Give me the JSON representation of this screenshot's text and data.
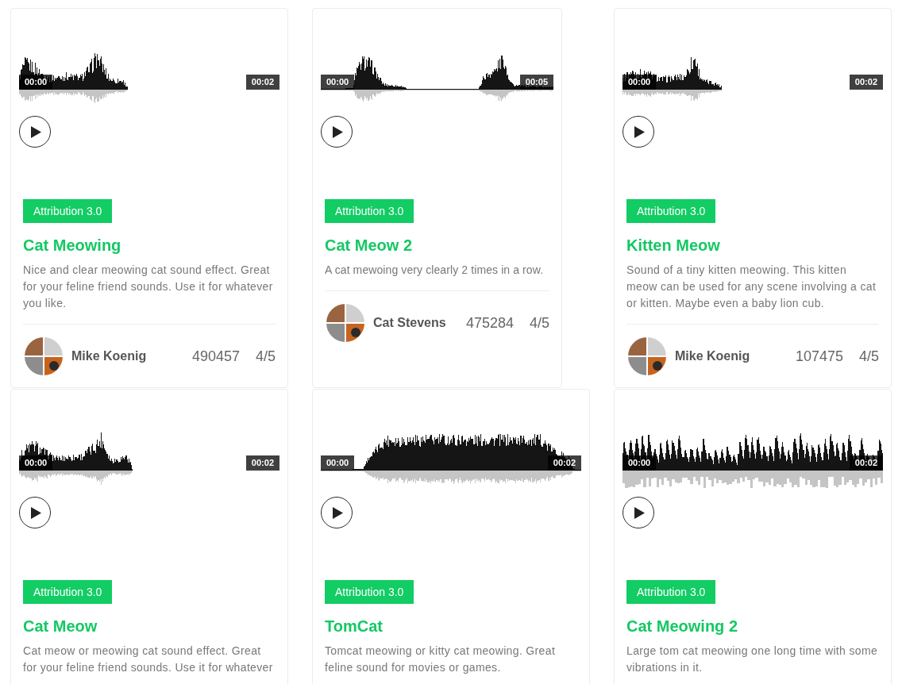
{
  "cards": [
    {
      "player": {
        "current_time": "00:00",
        "duration": "00:02"
      },
      "license": "Attribution 3.0",
      "title": "Cat Meowing",
      "description": "Nice and clear meowing cat sound effect. Great for your feline friend sounds. Use it for whatever you like.",
      "footer": {
        "author": "Mike Koenig",
        "downloads": "490457",
        "rating": "4/5"
      }
    },
    {
      "player": {
        "current_time": "00:00",
        "duration": "00:05"
      },
      "license": "Attribution 3.0",
      "title": "Cat Meow 2",
      "description": "A cat mewoing very clearly 2 times in a row.",
      "footer": {
        "author": "Cat Stevens",
        "downloads": "475284",
        "rating": "4/5"
      }
    },
    {
      "player": {
        "current_time": "00:00",
        "duration": "00:02"
      },
      "license": "Attribution 3.0",
      "title": "Kitten Meow",
      "description": "Sound of a tiny kitten meowing. This kitten meow can be used for any scene involving a cat or kitten. Maybe even a baby lion cub.",
      "footer": {
        "author": "Mike Koenig",
        "downloads": "107475",
        "rating": "4/5"
      }
    },
    {
      "player": {
        "current_time": "00:00",
        "duration": "00:02"
      },
      "license": "Attribution 3.0",
      "title": "Cat Meow",
      "description": "Cat meow or meowing cat sound effect. Great for your feline friend sounds. Use it for whatever"
    },
    {
      "player": {
        "current_time": "00:00",
        "duration": "00:02"
      },
      "license": "Attribution 3.0",
      "title": "TomCat",
      "description": "Tomcat meowing or kitty cat meowing. Great feline sound for movies or games."
    },
    {
      "player": {
        "current_time": "00:00",
        "duration": "00:02"
      },
      "license": "Attribution 3.0",
      "title": "Cat Meowing 2",
      "description": "Large tom cat meowing one long time with some vibrations in it."
    }
  ]
}
